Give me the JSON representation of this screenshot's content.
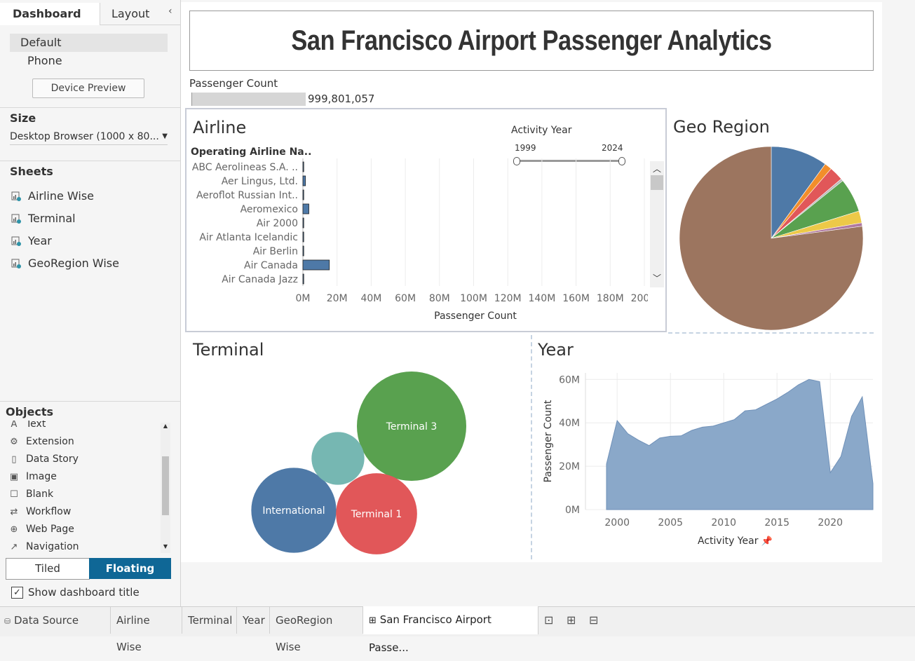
{
  "left_panel": {
    "tabs": [
      {
        "label": "Dashboard"
      },
      {
        "label": "Layout"
      }
    ],
    "device_list": [
      {
        "label": "Default"
      },
      {
        "label": "Phone"
      }
    ],
    "device_preview_label": "Device Preview",
    "size": {
      "title": "Size",
      "value": "Desktop Browser (1000 x 80..."
    },
    "sheets": {
      "title": "Sheets",
      "items": [
        {
          "label": "Airline Wise"
        },
        {
          "label": "Terminal"
        },
        {
          "label": "Year"
        },
        {
          "label": "GeoRegion Wise"
        }
      ]
    },
    "objects": {
      "title": "Objects",
      "items": [
        {
          "label": "Text",
          "icon": "text-icon"
        },
        {
          "label": "Extension",
          "icon": "extension-icon"
        },
        {
          "label": "Data Story",
          "icon": "book-icon"
        },
        {
          "label": "Image",
          "icon": "image-icon"
        },
        {
          "label": "Blank",
          "icon": "blank-icon"
        },
        {
          "label": "Workflow",
          "icon": "workflow-icon"
        },
        {
          "label": "Web Page",
          "icon": "globe-icon"
        },
        {
          "label": "Navigation",
          "icon": "navigation-icon"
        }
      ]
    },
    "layout_toggle": {
      "tiled": "Tiled",
      "floating": "Floating",
      "selected": "Floating"
    },
    "show_title_label": "Show dashboard title",
    "show_title_checked": true
  },
  "dashboard": {
    "title": "San Francisco Airport Passenger Analytics",
    "kpi": {
      "label": "Passenger Count",
      "value": "999,801,057"
    },
    "airline": {
      "title": "Airline",
      "column_header": "Operating Airline Na..",
      "filter": {
        "label": "Activity Year",
        "min": "1999",
        "max": "2024"
      },
      "x_axis_title": "Passenger Count"
    },
    "geo": {
      "title": "Geo Region"
    },
    "terminal": {
      "title": "Terminal"
    },
    "year": {
      "title": "Year",
      "x_axis_title": "Activity Year",
      "y_axis_title": "Passenger Count"
    }
  },
  "chart_data": [
    {
      "type": "bar",
      "title": "Airline",
      "orientation": "horizontal",
      "categories": [
        "ABC Aerolineas S.A. ..",
        "Aer Lingus, Ltd.",
        "Aeroflot Russian Int..",
        "Aeromexico",
        "Air 2000",
        "Air Atlanta Icelandic",
        "Air Berlin",
        "Air Canada",
        "Air Canada Jazz"
      ],
      "values": [
        0.5,
        1.5,
        0.4,
        3.5,
        0.1,
        0.1,
        0.2,
        15.5,
        0.5
      ],
      "value_unit": "M",
      "xlabel": "Passenger Count",
      "x_ticks": [
        "0M",
        "20M",
        "40M",
        "60M",
        "80M",
        "100M",
        "120M",
        "140M",
        "160M",
        "180M",
        "200M"
      ],
      "xlim": [
        0,
        200
      ],
      "color": "#4e79a7"
    },
    {
      "type": "pie",
      "title": "Geo Region",
      "slices": [
        {
          "value": 10.0,
          "color": "#4e79a7"
        },
        {
          "value": 1.3,
          "color": "#f28e2b"
        },
        {
          "value": 2.5,
          "color": "#e15759"
        },
        {
          "value": 0.4,
          "color": "#b8b8b8"
        },
        {
          "value": 6.0,
          "color": "#59a14f"
        },
        {
          "value": 2.1,
          "color": "#edc948"
        },
        {
          "value": 0.6,
          "color": "#b07aa1"
        },
        {
          "value": 77.1,
          "color": "#9c755f"
        }
      ]
    },
    {
      "type": "bubble",
      "title": "Terminal",
      "bubbles": [
        {
          "label": "Terminal 3",
          "value": 24,
          "color": "#59a14f"
        },
        {
          "label": "International",
          "value": 14.5,
          "color": "#4e79a7"
        },
        {
          "label": "Terminal 1",
          "value": 13.2,
          "color": "#e15759"
        },
        {
          "label": "",
          "value": 5.6,
          "color": "#76b7b2"
        }
      ]
    },
    {
      "type": "area",
      "title": "Year",
      "xlabel": "Activity Year",
      "ylabel": "Passenger Count",
      "x": [
        1999,
        2000,
        2001,
        2002,
        2003,
        2004,
        2005,
        2006,
        2007,
        2008,
        2009,
        2010,
        2011,
        2012,
        2013,
        2014,
        2015,
        2016,
        2017,
        2018,
        2019,
        2020,
        2021,
        2022,
        2023,
        2024
      ],
      "y": [
        21,
        41,
        35,
        32,
        29.5,
        33,
        33.8,
        34,
        36.5,
        38,
        38.5,
        40,
        41.5,
        45.5,
        46,
        48.5,
        51,
        54,
        57.5,
        60,
        59,
        17,
        24.5,
        43,
        52,
        12
      ],
      "value_unit": "M",
      "x_ticks": [
        2000,
        2005,
        2010,
        2015,
        2020
      ],
      "y_ticks": [
        "0M",
        "20M",
        "40M",
        "60M"
      ],
      "xlim": [
        1999,
        2024
      ],
      "ylim": [
        0,
        63
      ],
      "color": "#8aa8c9"
    }
  ],
  "bottom_tabs": [
    {
      "label": "Data Source",
      "icon": "database-icon"
    },
    {
      "label": "Airline Wise"
    },
    {
      "label": "Terminal"
    },
    {
      "label": "Year"
    },
    {
      "label": "GeoRegion Wise"
    },
    {
      "label": "San Francisco Airport Passe...",
      "icon": "dashboard-icon",
      "active": true
    }
  ]
}
